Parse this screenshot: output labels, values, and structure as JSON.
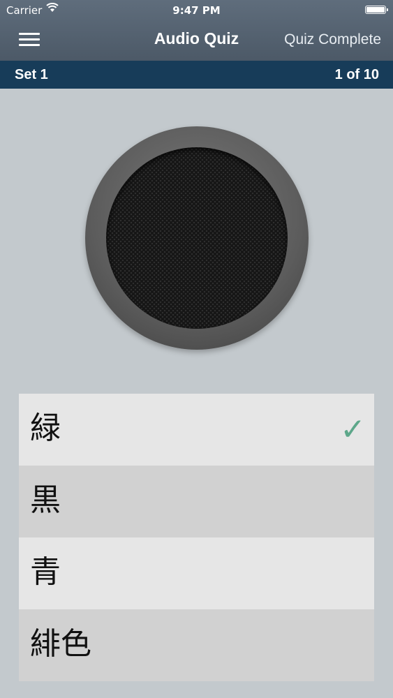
{
  "status_bar": {
    "carrier": "Carrier",
    "time": "9:47 PM"
  },
  "nav": {
    "title": "Audio Quiz",
    "right_button": "Quiz Complete"
  },
  "set_bar": {
    "set_label": "Set 1",
    "progress": "1 of 10"
  },
  "answers": [
    {
      "label": "緑",
      "selected": true,
      "check": "✓"
    },
    {
      "label": "黒",
      "selected": false
    },
    {
      "label": "青",
      "selected": false
    },
    {
      "label": "緋色",
      "selected": false
    }
  ],
  "colors": {
    "nav_bg": "#56636f",
    "set_bar_bg": "#173c59",
    "check": "#5da78a"
  }
}
